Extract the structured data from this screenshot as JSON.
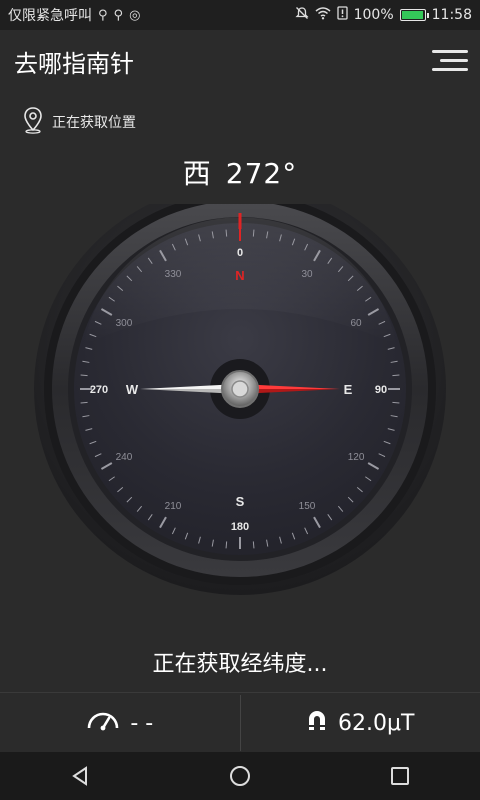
{
  "status_bar": {
    "left_text": "仅限紧急呼叫",
    "battery_percent": "100%",
    "battery_level": 1.0,
    "time": "11:58"
  },
  "app": {
    "title": "去哪指南针"
  },
  "location": {
    "status": "正在获取位置"
  },
  "heading": {
    "direction": "西",
    "degrees": "272°",
    "degree_value": 272
  },
  "compass": {
    "cardinals": {
      "n": "N",
      "e": "E",
      "s": "S",
      "w": "W"
    },
    "degree_labels": [
      "0",
      "30",
      "60",
      "90",
      "120",
      "150",
      "180",
      "210",
      "240",
      "270",
      "300",
      "330"
    ]
  },
  "coords": {
    "status": "正在获取经纬度..."
  },
  "info": {
    "speed": "- -",
    "magnetic": "62.0μT"
  },
  "colors": {
    "accent": "#e02424",
    "background": "#2b2b2b",
    "battery": "#34c759"
  }
}
